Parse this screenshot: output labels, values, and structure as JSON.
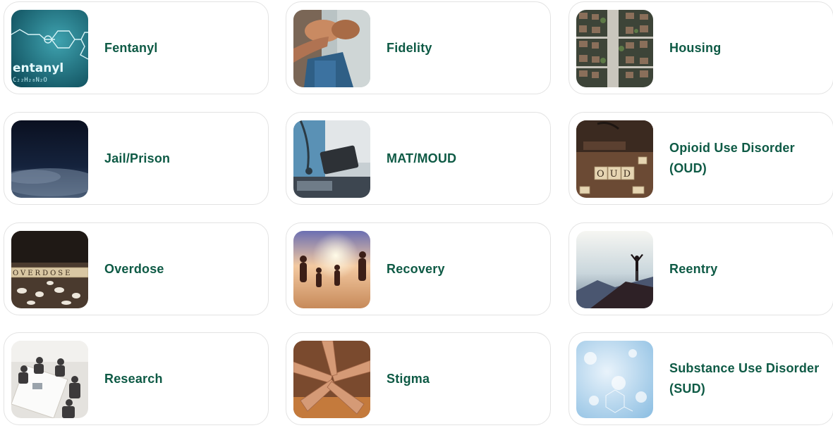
{
  "topics": [
    {
      "label": "Fentanyl",
      "image": "fentanyl-molecule-image",
      "thumb_text": "entanyl"
    },
    {
      "label": "Fidelity",
      "image": "fist-bump-image"
    },
    {
      "label": "Housing",
      "image": "neighborhood-aerial-image"
    },
    {
      "label": "Jail/Prison",
      "image": "dark-fog-image"
    },
    {
      "label": "MAT/MOUD",
      "image": "doctor-tablet-image"
    },
    {
      "label": "Opioid Use Disorder (OUD)",
      "image": "oud-letter-tiles-image",
      "thumb_text": "OUD"
    },
    {
      "label": "Overdose",
      "image": "overdose-letter-tiles-image",
      "thumb_text": "OVERDOSE"
    },
    {
      "label": "Recovery",
      "image": "family-beach-sunset-image"
    },
    {
      "label": "Reentry",
      "image": "mountain-summit-image"
    },
    {
      "label": "Research",
      "image": "meeting-table-image"
    },
    {
      "label": "Stigma",
      "image": "stacked-hands-image"
    },
    {
      "label": "Substance Use Disorder (SUD)",
      "image": "blue-molecule-bokeh-image"
    }
  ],
  "colors": {
    "label": "#0e5a45",
    "card_border": "#e3e3e3"
  }
}
